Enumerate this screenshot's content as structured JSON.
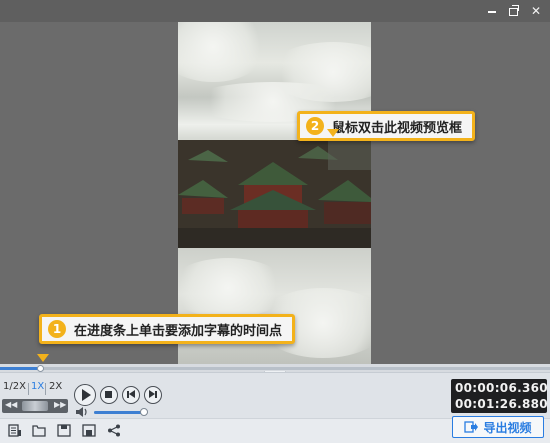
{
  "window": {
    "controls": [
      "minimize-icon",
      "restore-icon",
      "close-icon"
    ]
  },
  "preview": {
    "hint_double_click": {
      "number": "2",
      "text": "鼠标双击此视频预览框"
    },
    "hint_timeline": {
      "number": "1",
      "text": "在进度条上单击要添加字幕的时间点"
    }
  },
  "timeline": {
    "progress": 0.073
  },
  "controls": {
    "speeds": [
      "1/2X",
      "1X",
      "2X"
    ],
    "active_speed": "1X",
    "volume": 0.93,
    "time_current": "00:00:06.360",
    "time_total": "00:01:26.880"
  },
  "toolbar": {
    "icons": [
      "new-project-icon",
      "open-folder-icon",
      "save-icon",
      "save-as-icon",
      "share-icon"
    ],
    "export_label": "导出视频"
  },
  "colors": {
    "accent": "#2a7de1",
    "callout": "#f3b21b"
  }
}
